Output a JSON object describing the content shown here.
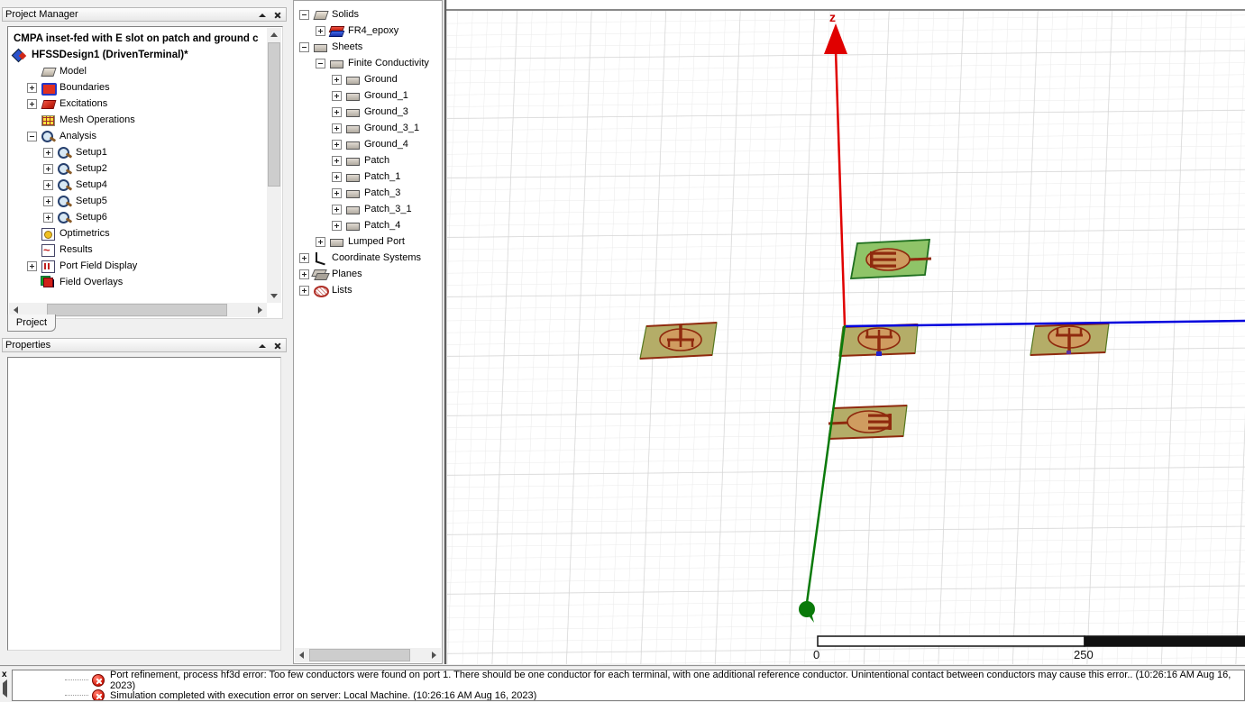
{
  "project_manager": {
    "title": "Project Manager",
    "project_name": "CMPA inset-fed with E slot on patch and ground c",
    "design_name": "HFSSDesign1 (DrivenTerminal)*",
    "items": [
      {
        "label": "Model"
      },
      {
        "label": "Boundaries"
      },
      {
        "label": "Excitations"
      },
      {
        "label": "Mesh Operations"
      },
      {
        "label": "Analysis"
      },
      {
        "label": "Setup1"
      },
      {
        "label": "Setup2"
      },
      {
        "label": "Setup4"
      },
      {
        "label": "Setup5"
      },
      {
        "label": "Setup6"
      },
      {
        "label": "Optimetrics"
      },
      {
        "label": "Results"
      },
      {
        "label": "Port Field Display"
      },
      {
        "label": "Field Overlays"
      }
    ],
    "tab_label": "Project"
  },
  "properties_panel": {
    "title": "Properties"
  },
  "model_tree": {
    "items": [
      {
        "label": "Solids"
      },
      {
        "label": "FR4_epoxy"
      },
      {
        "label": "Sheets"
      },
      {
        "label": "Finite Conductivity"
      },
      {
        "label": "Ground"
      },
      {
        "label": "Ground_1"
      },
      {
        "label": "Ground_3"
      },
      {
        "label": "Ground_3_1"
      },
      {
        "label": "Ground_4"
      },
      {
        "label": "Patch"
      },
      {
        "label": "Patch_1"
      },
      {
        "label": "Patch_3"
      },
      {
        "label": "Patch_3_1"
      },
      {
        "label": "Patch_4"
      },
      {
        "label": "Lumped Port"
      },
      {
        "label": "Coordinate Systems"
      },
      {
        "label": "Planes"
      },
      {
        "label": "Lists"
      }
    ]
  },
  "viewport": {
    "z_axis_label": "z",
    "ruler": {
      "origin_label": "0",
      "mid_label": "250"
    },
    "colors": {
      "x_axis": "#0000dd",
      "y_axis": "#0a7a0a",
      "z_axis": "#e00000",
      "patch_green": "#8fc468",
      "patch_olive": "#b4ad68",
      "slot_red": "#8f2a0e",
      "ellipse_fill": "#cf9c60",
      "grid_minor": "#e9e9e9",
      "grid_major": "#d5d5d5",
      "port_blue": "#2222cc"
    }
  },
  "messages": {
    "items": [
      {
        "text": "Port refinement, process hf3d error: Too few conductors were found on port 1.  There should be one conductor for each terminal, with one additional reference conductor.  Unintentional contact between conductors may cause this error.. (10:26:16 AM  Aug 16, 2023)"
      },
      {
        "text": "Simulation completed with execution error on server: Local Machine. (10:26:16 AM  Aug 16, 2023)"
      }
    ]
  }
}
